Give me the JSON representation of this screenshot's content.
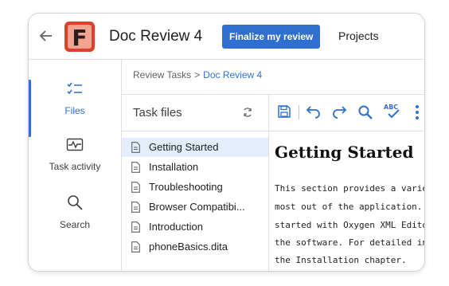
{
  "header": {
    "logo_letter": "F",
    "title": "Doc Review 4",
    "finalize_label": "Finalize my review",
    "projects_label": "Projects"
  },
  "sidebar": {
    "items": [
      {
        "label": "Files",
        "icon": "files-checklist-icon",
        "active": true
      },
      {
        "label": "Task activity",
        "icon": "activity-icon",
        "active": false
      },
      {
        "label": "Search",
        "icon": "search-icon",
        "active": false
      }
    ]
  },
  "breadcrumb": {
    "root": "Review Tasks",
    "separator": ">",
    "current": "Doc Review 4"
  },
  "files": {
    "heading": "Task files",
    "items": [
      {
        "name": "Getting Started",
        "selected": true
      },
      {
        "name": "Installation",
        "selected": false
      },
      {
        "name": "Troubleshooting",
        "selected": false
      },
      {
        "name": "Browser Compatibi...",
        "selected": false
      },
      {
        "name": "Introduction",
        "selected": false
      },
      {
        "name": "phoneBasics.dita",
        "selected": false
      }
    ]
  },
  "toolbar": {
    "icons": [
      "save-icon",
      "undo-icon",
      "redo-icon",
      "find-icon",
      "spellcheck-icon",
      "more-icon"
    ],
    "spellcheck_text": "ABC"
  },
  "document": {
    "heading": "Getting Started",
    "lines": [
      "This section provides a variety of",
      "most out of the application. Typi",
      "started with Oxygen XML Editor[",
      "the software. For detailed inform",
      "the Installation chapter."
    ]
  },
  "colors": {
    "accent": "#2f6fd0",
    "logo_red": "#d9412b",
    "selection": "#e3edfb"
  }
}
